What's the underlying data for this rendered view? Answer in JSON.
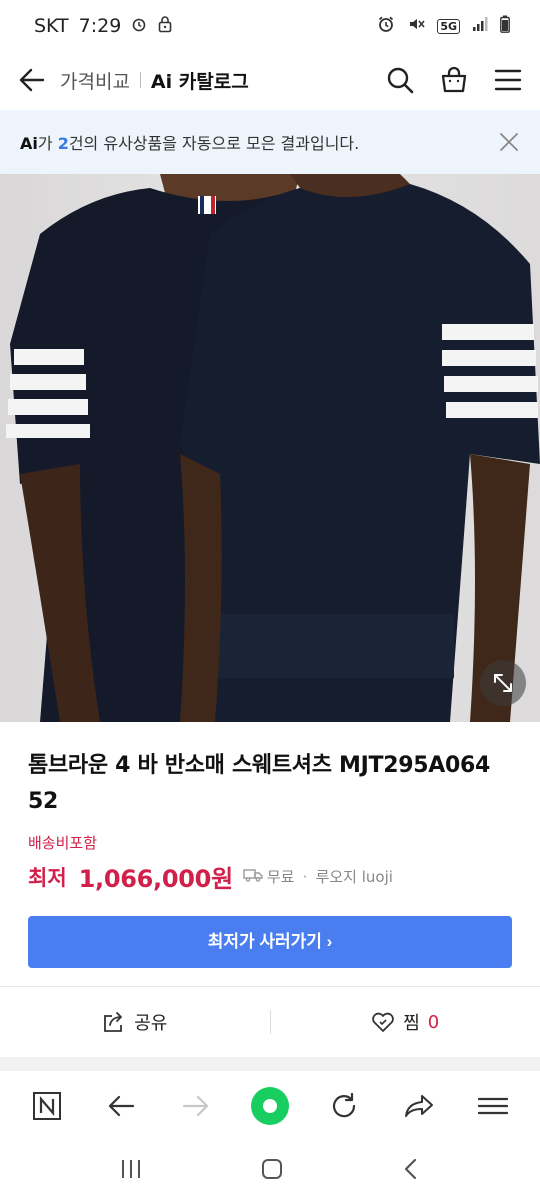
{
  "status_bar": {
    "carrier": "SKT",
    "time": "7:29",
    "network": "5G"
  },
  "header": {
    "compare_label": "가격비교",
    "ai_catalog_label": "Ai 카탈로그"
  },
  "notice": {
    "ai_mark": "Ai",
    "prefix": "가 ",
    "count": "2",
    "suffix": "건의 유사상품을 자동으로 모은 결과입니다."
  },
  "product": {
    "title_line1": "톰브라운 4 바 반소매 스웨트셔츠 MJT295A064",
    "title_line2": "52",
    "shipping_note": "배송비포함",
    "price_label": "최저",
    "price_value": "1,066,000원",
    "free_shipping": "무료",
    "seller": "루오지 luoji",
    "buy_button": "최저가 사러가기 ›"
  },
  "actions": {
    "share_label": "공유",
    "wish_label": "찜",
    "wish_count": "0"
  },
  "colors": {
    "accent_red": "#d1204a",
    "button_blue": "#4a7ef0",
    "notice_bg": "#eef4fb",
    "naver_green": "#19ce60"
  },
  "icons": {
    "back": "arrow-left-icon",
    "search": "search-icon",
    "cart": "cart-icon",
    "menu": "hamburger-icon",
    "close": "close-icon",
    "expand": "expand-icon",
    "share": "share-icon",
    "heart": "heart-icon",
    "naver": "naver-n-icon",
    "browser_back": "arrow-left-icon",
    "browser_forward": "arrow-right-icon",
    "home": "green-dot-icon",
    "refresh": "refresh-icon",
    "browser_share": "share-arrow-icon",
    "browser_menu": "menu-icon"
  }
}
